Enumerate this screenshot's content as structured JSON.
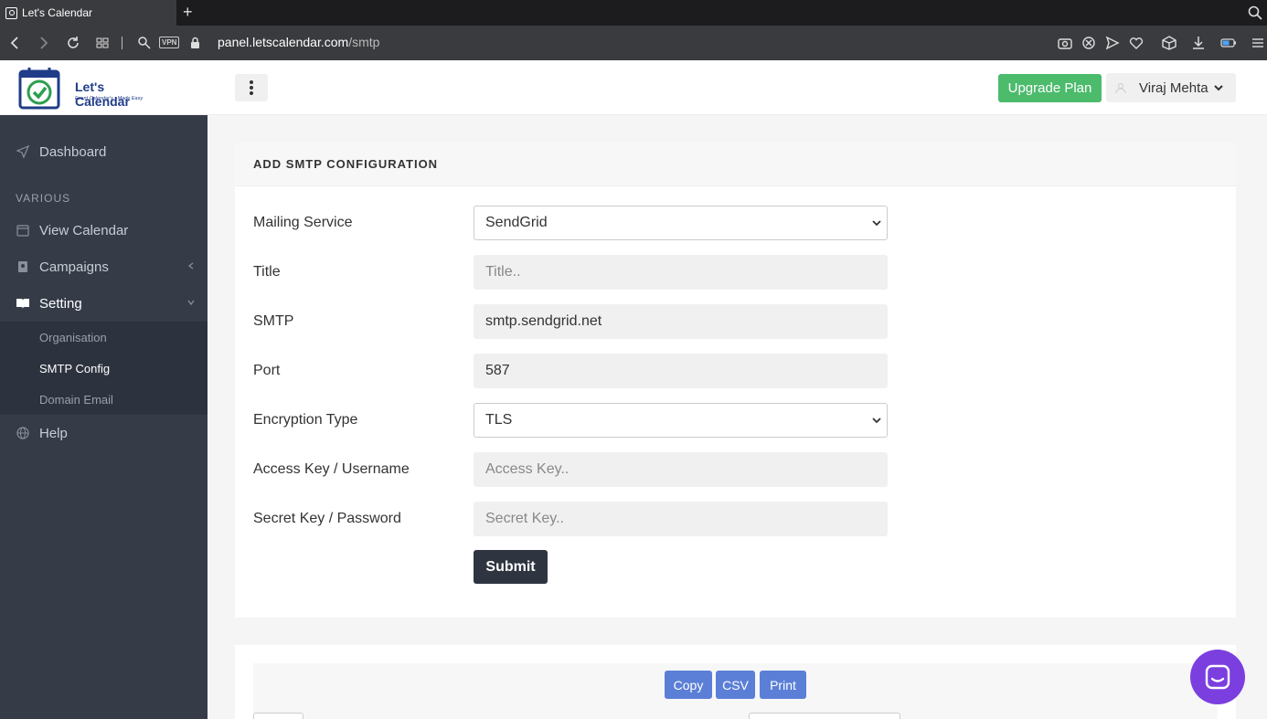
{
  "browser": {
    "tab_title": "Let's Calendar",
    "url_host": "panel.letscalendar.com",
    "url_path": "/smtp",
    "vpn_label": "VPN"
  },
  "header": {
    "logo_title": "Let's Calendar",
    "logo_tagline": "Event Calendar's - Made Easy",
    "upgrade_label": "Upgrade Plan",
    "user_name": "Viraj Mehta"
  },
  "sidebar": {
    "dashboard": "Dashboard",
    "section": "VARIOUS",
    "items": [
      {
        "label": "View Calendar"
      },
      {
        "label": "Campaigns"
      },
      {
        "label": "Setting"
      },
      {
        "label": "Help"
      }
    ],
    "submenu": [
      {
        "label": "Organisation"
      },
      {
        "label": "SMTP Config"
      },
      {
        "label": "Domain Email"
      }
    ]
  },
  "form": {
    "heading": "ADD SMTP CONFIGURATION",
    "mailing_service_label": "Mailing Service",
    "mailing_service_value": "SendGrid",
    "title_label": "Title",
    "title_placeholder": "Title..",
    "smtp_label": "SMTP",
    "smtp_value": "smtp.sendgrid.net",
    "port_label": "Port",
    "port_value": "587",
    "encryption_label": "Encryption Type",
    "encryption_value": "TLS",
    "access_label": "Access Key / Username",
    "access_placeholder": "Access Key..",
    "secret_label": "Secret Key / Password",
    "secret_placeholder": "Secret Key..",
    "submit_label": "Submit"
  },
  "table_tools": {
    "copy_label": "Copy",
    "csv_label": "CSV",
    "print_label": "Print"
  },
  "colors": {
    "accent_green": "#4cbb6c",
    "sidebar_bg": "#353c48",
    "export_blue": "#5b7fd6",
    "chat_purple": "#7b3fe0"
  }
}
